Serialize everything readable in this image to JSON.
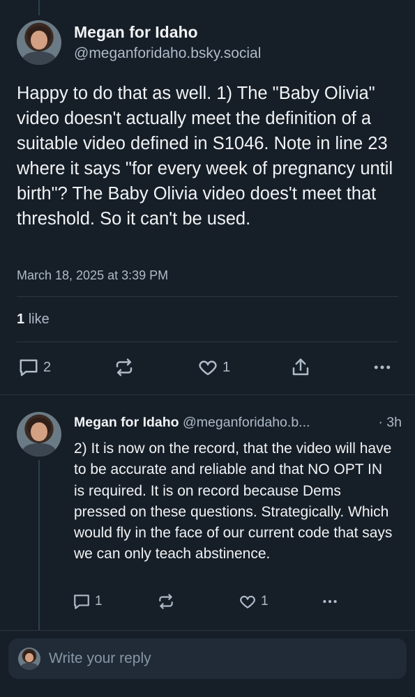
{
  "post": {
    "author_name": "Megan for Idaho",
    "author_handle": "@meganforidaho.bsky.social",
    "text": "Happy to do that as well. 1) The \"Baby Olivia\" video doesn't actually meet the definition of a  suitable video defined in S1046. Note in line 23 where it says \"for every week of pregnancy until birth\"? The Baby Olivia video does't meet that threshold. So it can't be used.",
    "date": "March 18, 2025 at 3:39 PM",
    "like_count": "1",
    "like_label": "like",
    "actions": {
      "reply_count": "2",
      "like_count": "1"
    }
  },
  "reply": {
    "author_name": "Megan for Idaho",
    "author_handle": "@meganforidaho.b...",
    "time": "· 3h",
    "text": "2) It is now on the record, that the video will have to be accurate and reliable and that NO OPT IN is required. It is on record because Dems pressed on these questions. Strategically. Which would fly in the face of our current code that says we can only teach abstinence.",
    "actions": {
      "reply_count": "1",
      "like_count": "1"
    }
  },
  "composer": {
    "placeholder": "Write your reply"
  },
  "colors": {
    "background": "#161e27",
    "text": "#f1f3f5",
    "muted": "#aebbc9",
    "divider": "#2a3744"
  },
  "icons": [
    "reply-icon",
    "repost-icon",
    "like-icon",
    "share-icon",
    "more-icon"
  ]
}
